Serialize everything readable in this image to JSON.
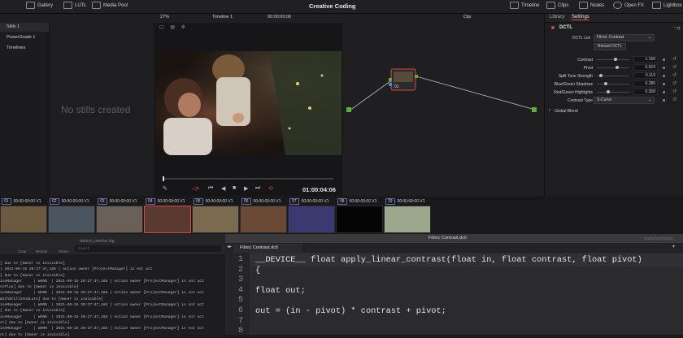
{
  "topbar": {
    "gallery": "Gallery",
    "luts": "LUTs",
    "media_pool": "Media Pool",
    "app_title": "Creative Coding",
    "timeline": "Timeline",
    "clips": "Clips",
    "nodes": "Nodes",
    "open_fx": "Open FX",
    "lightbox": "Lightbox"
  },
  "subbar": {
    "zoom": "27%",
    "timeline_name": "Timeline 1",
    "timecode": "00:00:00:00",
    "clip_label": "Clip",
    "library_tab": "Library",
    "settings_tab": "Settings"
  },
  "left": {
    "items": [
      "Stills 1",
      "PowerGrade 1",
      "Timelines"
    ],
    "empty_message": "No stills created"
  },
  "viewer": {
    "timecode": "01:00:04:06"
  },
  "node": {
    "label": "01"
  },
  "dctl": {
    "header": "DCTL",
    "list_label": "DCTL List",
    "list_value": "Filmic Contrast",
    "reload_button": "Reload DCTL",
    "params": [
      {
        "label": "Contrast",
        "value": "1.156",
        "pos": 0.58
      },
      {
        "label": "Pivot",
        "value": "0.624",
        "pos": 0.62
      },
      {
        "label": "Split Tone Strength",
        "value": "0.119",
        "pos": 0.12
      },
      {
        "label": "Blue/Green Shadows",
        "value": "0.285",
        "pos": 0.28
      },
      {
        "label": "Red/Green Highlights",
        "value": "0.358",
        "pos": 0.36
      }
    ],
    "contrast_type_label": "Contrast Type",
    "contrast_type_value": "S-Curve",
    "global_blend": "Global Blend"
  },
  "timeline_clips": [
    {
      "num": "01",
      "tc": "00:00:00:00",
      "track": "V1",
      "bg": "#6b5a3f"
    },
    {
      "num": "02",
      "tc": "00:00:00:00",
      "track": "V1",
      "bg": "#4a5560"
    },
    {
      "num": "03",
      "tc": "00:00:00:00",
      "track": "V1",
      "bg": "#6a6058"
    },
    {
      "num": "04",
      "tc": "00:00:00:00",
      "track": "V1",
      "bg": "#5a3a30"
    },
    {
      "num": "05",
      "tc": "00:00:00:00",
      "track": "V1",
      "bg": "#7a6a50"
    },
    {
      "num": "06",
      "tc": "00:00:00:00",
      "track": "V1",
      "bg": "#6a4a36"
    },
    {
      "num": "07",
      "tc": "00:00:00:00",
      "track": "V1",
      "bg": "#3a3a70"
    },
    {
      "num": "08",
      "tc": "00:00:00:00",
      "track": "V1",
      "bg": "#050505"
    },
    {
      "num": "29",
      "tc": "00:00:00:00",
      "track": "V1",
      "bg": "#9aa88e"
    }
  ],
  "console": {
    "buttons": [
      "Clear",
      "Reload",
      "Share"
    ],
    "search_placeholder": "Search",
    "file": "davinci_resolve.log",
    "lines": [
      "] due to [Owner is invisible]",
      "| 2021-09-15 20:27:47,166 | Action owner [ProjectManager] is not act",
      "] due to [Owner is invisible]",
      "ionManager     | WARN  | 2021-09-15 20:27:47,166 | Action owner [ProjectManager] is not act",
      "ctPlus] due to [Owner is invisible]",
      "ionManager     | WARN  | 2021-09-15 20:27:47,166 | Action owner [ProjectManager] is not act",
      "WithStillsAndLuts] due to [Owner is invisible]",
      "ionManager     | WARN  | 2021-09-15 20:27:47,166 | Action owner [ProjectManager] is not act",
      "] due to [Owner is invisible]",
      "ionManager     | WARN  | 2021-09-15 20:27:47,166 | Action owner [ProjectManager] is not act",
      "ct] due to [Owner is invisible]",
      "ionManager     | WARN  | 2021-09-15 20:27:47,166 | Action owner [ProjectManager] is not act",
      "ct] due to [Owner is invisible]"
    ]
  },
  "editor": {
    "window_title": "Filmic Contrast.dctl",
    "tab": "Filmic Contrast.dctl",
    "right_label": "UNREGISTERED",
    "lines": [
      {
        "n": "1",
        "text": "__DEVICE__ float apply_linear_contrast(float in, float contrast, float pivot)"
      },
      {
        "n": "2",
        "text": "{"
      },
      {
        "n": "3",
        "text": ""
      },
      {
        "n": "4",
        "text": "float out;"
      },
      {
        "n": "5",
        "text": ""
      },
      {
        "n": "6",
        "text": "out = (in - pivot) * contrast + pivot;"
      },
      {
        "n": "7",
        "text": ""
      },
      {
        "n": "8",
        "text": ""
      }
    ]
  }
}
